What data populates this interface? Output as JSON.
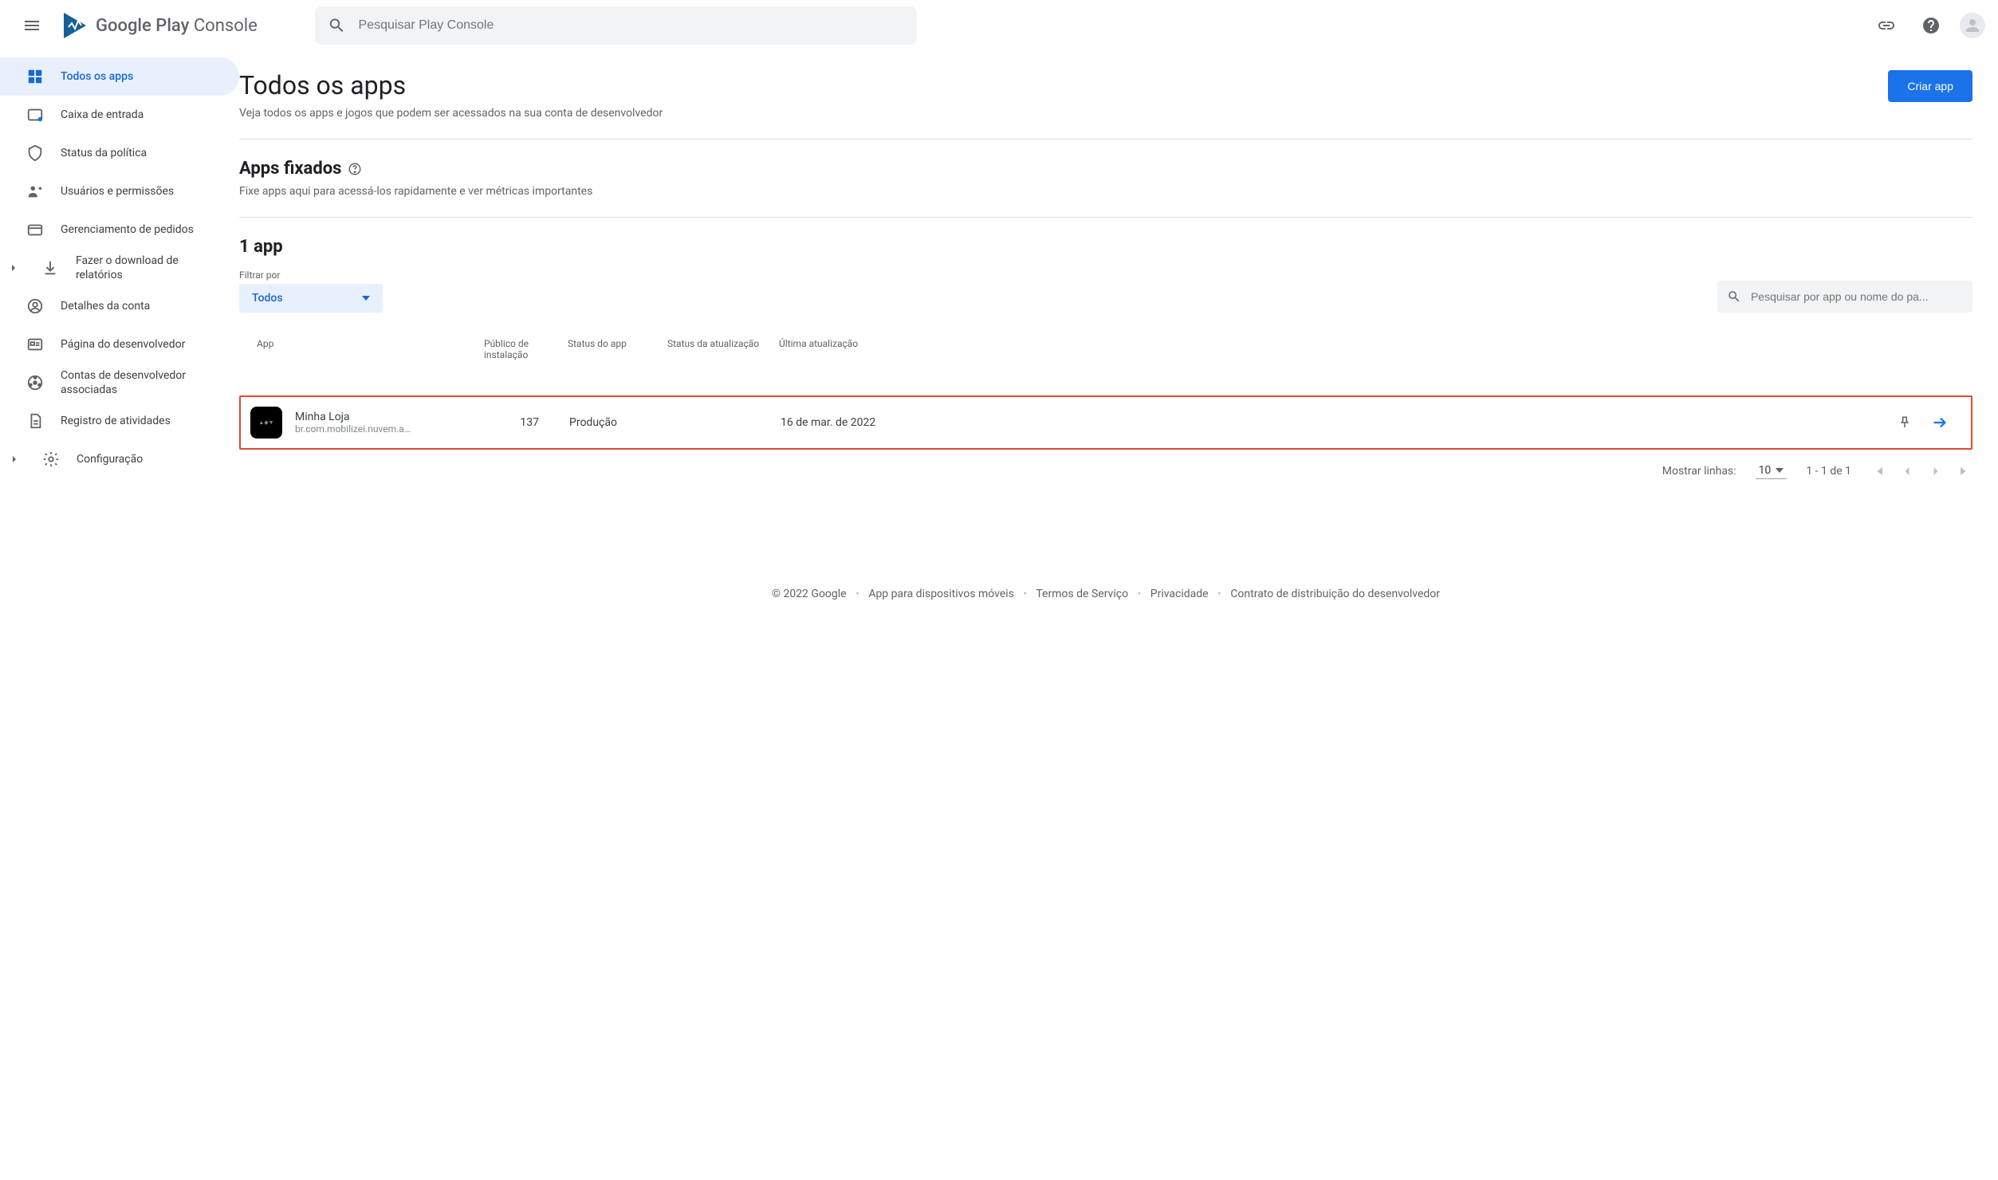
{
  "header": {
    "logo_text_bold": "Google Play",
    "logo_text_light": " Console",
    "search_placeholder": "Pesquisar Play Console"
  },
  "sidebar": {
    "items": [
      {
        "label": "Todos os apps",
        "active": true
      },
      {
        "label": "Caixa de entrada"
      },
      {
        "label": "Status da política"
      },
      {
        "label": "Usuários e permissões"
      },
      {
        "label": "Gerenciamento de pedidos"
      },
      {
        "label": "Fazer o download de relatórios",
        "caret": true
      },
      {
        "label": "Detalhes da conta"
      },
      {
        "label": "Página do desenvolvedor"
      },
      {
        "label": "Contas de desenvolvedor associadas"
      },
      {
        "label": "Registro de atividades"
      },
      {
        "label": "Configuração",
        "caret": true
      }
    ]
  },
  "page": {
    "title": "Todos os apps",
    "subtitle": "Veja todos os apps e jogos que podem ser acessados na sua conta de desenvolvedor",
    "create_button": "Criar app"
  },
  "pinned": {
    "title": "Apps fixados",
    "desc": "Fixe apps aqui para acessá-los rapidamente e ver métricas importantes"
  },
  "apps": {
    "count_title": "1 app",
    "filter_label": "Filtrar por",
    "filter_value": "Todos",
    "search_placeholder": "Pesquisar por app ou nome do pa...",
    "columns": {
      "app": "App",
      "installs": "Público de instalação",
      "status": "Status do app",
      "update_status": "Status da atualização",
      "last_update": "Última atualização"
    },
    "rows": [
      {
        "name": "Minha Loja",
        "package": "br.com.mobilizei.nuvem.a…",
        "installs": "137",
        "status": "Produção",
        "update_status": "",
        "last_update": "16 de mar. de 2022"
      }
    ]
  },
  "pagination": {
    "rows_label": "Mostrar linhas:",
    "rows_value": "10",
    "range": "1 - 1 de 1"
  },
  "footer": {
    "copyright": "© 2022 Google",
    "links": [
      "App para dispositivos móveis",
      "Termos de Serviço",
      "Privacidade",
      "Contrato de distribuição do desenvolvedor"
    ]
  }
}
